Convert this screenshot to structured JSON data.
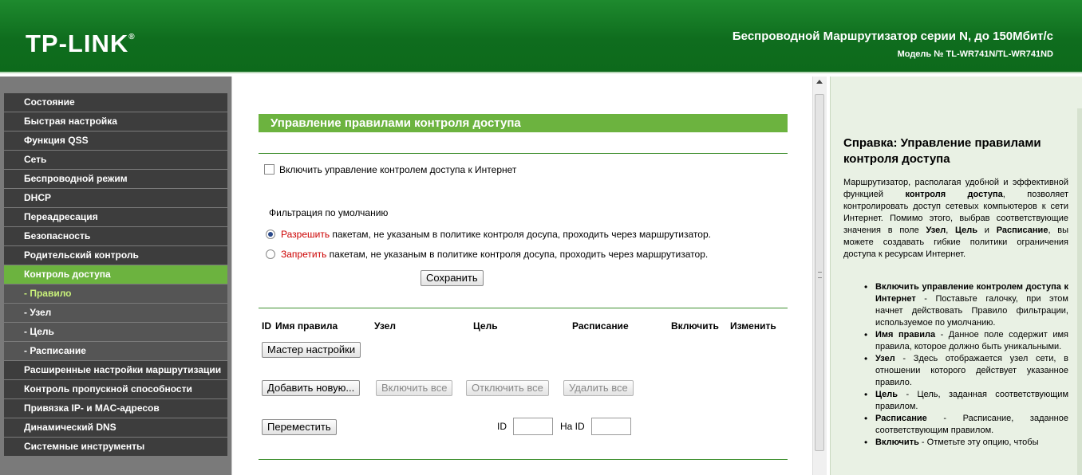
{
  "header": {
    "logo": "TP-LINK",
    "title": "Беспроводной Маршрутизатор серии N, до 150Мбит/с",
    "model": "Модель № TL-WR741N/TL-WR741ND"
  },
  "sidebar": {
    "items": [
      {
        "label": "Состояние"
      },
      {
        "label": "Быстрая настройка"
      },
      {
        "label": "Функция QSS"
      },
      {
        "label": "Сеть"
      },
      {
        "label": "Беспроводной режим"
      },
      {
        "label": "DHCP"
      },
      {
        "label": "Переадресация"
      },
      {
        "label": "Безопасность"
      },
      {
        "label": "Родительский контроль"
      },
      {
        "label": "Контроль доступа"
      },
      {
        "label": "- Правило"
      },
      {
        "label": "- Узел"
      },
      {
        "label": "- Цель"
      },
      {
        "label": "- Расписание"
      },
      {
        "label": "Расширенные настройки маршрутизации"
      },
      {
        "label": "Контроль пропускной способности"
      },
      {
        "label": "Привязка IP- и MAC-адресов"
      },
      {
        "label": "Динамический DNS"
      },
      {
        "label": "Системные инструменты"
      }
    ]
  },
  "main": {
    "title": "Управление правилами контроля доступа",
    "enable_label": "Включить управление контролем доступа к Интернет",
    "filter_heading": "Фильтрация по умолчанию",
    "allow_word": "Разрешить",
    "allow_rest": " пакетам, не указаным в политике контроля досупа, проходить через маршрутизатор.",
    "deny_word": "Запретить",
    "deny_rest": " пакетам, не указаным в политике контроля досупа, проходить через маршрутизатор.",
    "save": "Сохранить",
    "columns": [
      "ID",
      "Имя правила",
      "Узел",
      "Цель",
      "Расписание",
      "Включить",
      "Изменить"
    ],
    "wizard": "Мастер настройки",
    "add_new": "Добавить новую...",
    "enable_all": "Включить все",
    "disable_all": "Отключить все",
    "delete_all": "Удалить все",
    "move": "Переместить",
    "id_label": "ID",
    "to_id_label": "На ID"
  },
  "help": {
    "title": "Справка: Управление правилами контроля доступа",
    "intro_1": "Маршрутизатор, располагая удобной и эффективной функцией ",
    "intro_b1": "контроля доступа",
    "intro_2": ", позволяет контролировать доступ сетевых компьютеров к сети Интернет. Помимо этого, выбрав соответствующие значения в поле ",
    "intro_b2": "Узел",
    "intro_3": ", ",
    "intro_b3": "Цель",
    "intro_4": " и ",
    "intro_b4": "Расписание",
    "intro_5": ", вы можете создавать гибкие политики ограничения доступа к ресурсам Интернет.",
    "items": [
      {
        "term": "Включить управление контролем доступа к Интернет",
        "desc": " - Поставьте галочку, при этом начнет действовать Правило фильтрации, используемое по умолчанию."
      },
      {
        "term": "Имя правила",
        "desc": " - Данное поле содержит имя правила, которое должно быть уникальными."
      },
      {
        "term": "Узел",
        "desc": " - Здесь отображается узел сети, в отношении которого действует указанное правило."
      },
      {
        "term": "Цель",
        "desc": " - Цель, заданная соответствующим правилом."
      },
      {
        "term": "Расписание",
        "desc": " - Расписание, заданное соответствующим правилом."
      },
      {
        "term": "Включить",
        "desc": " - Отметьте эту опцию, чтобы"
      }
    ]
  }
}
